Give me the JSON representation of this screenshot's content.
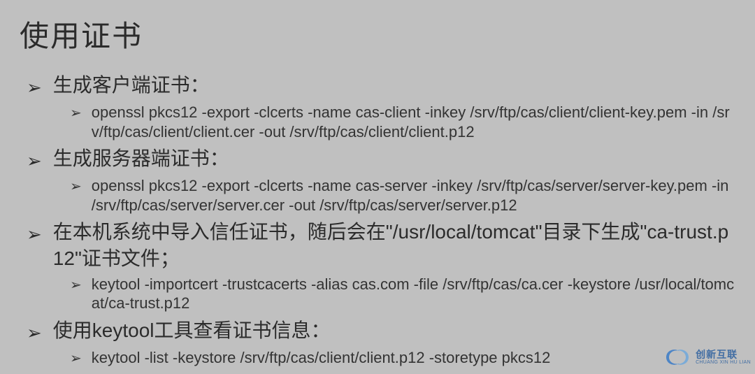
{
  "title": "使用证书",
  "items": [
    {
      "text": "生成客户端证书：",
      "sub": [
        {
          "text": "openssl pkcs12 -export -clcerts -name cas-client -inkey /srv/ftp/cas/client/client-key.pem -in /srv/ftp/cas/client/client.cer -out /srv/ftp/cas/client/client.p12"
        }
      ]
    },
    {
      "text": "生成服务器端证书：",
      "sub": [
        {
          "text": "openssl pkcs12 -export -clcerts -name cas-server -inkey /srv/ftp/cas/server/server-key.pem  -in /srv/ftp/cas/server/server.cer -out /srv/ftp/cas/server/server.p12"
        }
      ]
    },
    {
      "text": "在本机系统中导入信任证书，随后会在\"/usr/local/tomcat\"目录下生成\"ca-trust.p12\"证书文件；",
      "sub": [
        {
          "text": "keytool -importcert -trustcacerts -alias cas.com -file /srv/ftp/cas/ca.cer -keystore /usr/local/tomcat/ca-trust.p12"
        }
      ]
    },
    {
      "text": "使用keytool工具查看证书信息：",
      "sub": [
        {
          "text": "keytool -list -keystore /srv/ftp/cas/client/client.p12 -storetype pkcs12"
        }
      ]
    }
  ],
  "watermark": {
    "cn": "创新互联",
    "en": "CHUANG XIN HU LIAN"
  }
}
